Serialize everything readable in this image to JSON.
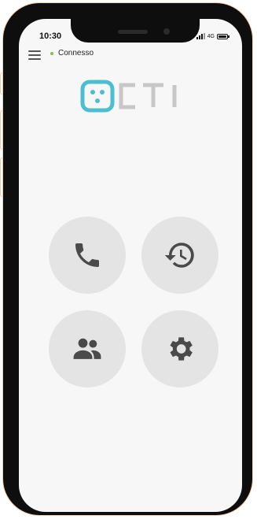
{
  "status_bar": {
    "time": "10:30",
    "network": "4G"
  },
  "app": {
    "connection_status": "Connesso",
    "brand_logo_text": "CTI",
    "colors": {
      "accent": "#4bbfd0",
      "status_dot": "#7cc34a",
      "button_bg": "#e4e4e4",
      "icon": "#4a4a4a"
    }
  },
  "actions": [
    {
      "name": "phone-icon"
    },
    {
      "name": "history-icon"
    },
    {
      "name": "contacts-icon"
    },
    {
      "name": "settings-icon"
    }
  ]
}
